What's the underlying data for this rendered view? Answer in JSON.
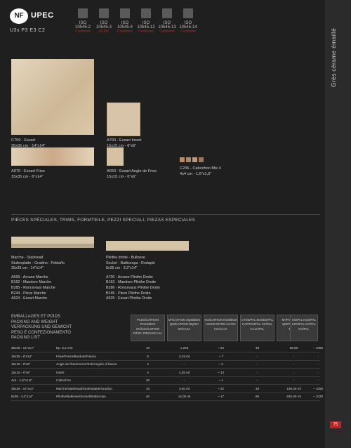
{
  "side_label": "Grès cérame émaillé",
  "logos": {
    "nf": "NF",
    "upec": "UPEC",
    "classification": "U3s P3 E3 C2"
  },
  "norms": [
    {
      "t1": "ISO",
      "t2": "10545-2",
      "t3": "Conforme"
    },
    {
      "t1": "ISO",
      "t2": "10545-3",
      "t3": "≤0,5%"
    },
    {
      "t1": "ISO",
      "t2": "10545-4",
      "t3": "Conforme"
    },
    {
      "t1": "ISO",
      "t2": "10545-12",
      "t3": "Conforme"
    },
    {
      "t1": "ISO",
      "t2": "10545-13",
      "t3": "Conforme"
    },
    {
      "t1": "ISO",
      "t2": "10545-14",
      "t3": "Conforme"
    }
  ],
  "products": {
    "big": {
      "code": "C759 - Essart",
      "size": "35x35 cm - 14\"x14\""
    },
    "insert": {
      "code": "A793 - Essart Insert",
      "size": "15x15 cm - 6\"x6\""
    },
    "frise": {
      "code": "A970 - Essart Frise",
      "size": "15x35 cm - 6\"x14\""
    },
    "angle": {
      "code": "A650 - Essart Angle de Frise",
      "size": "15x15 cm - 6\"x6\""
    },
    "cabochon": {
      "code": "C236 - Cabochon Mix 4",
      "size": "4x4 cm - 1,6\"x1,6\""
    }
  },
  "special_title": "PIÈCES SPÉCIALES, TRIMS, FORMTEILE, PEZZI SPECIALI, PIEZAS ESPECIALES",
  "marche": {
    "title1": "Marche - Stairtread",
    "title2": "Stufenplatte - Gradino - Peldaño",
    "size": "35x35 cm - 14\"x14\"",
    "items": [
      "A699 - Arcane Marche",
      "B162 - Mandore Marche",
      "B285 - Roncevaux Marche",
      "B244 - Pieve Marche",
      "A924 - Essart Marche"
    ]
  },
  "plinthe": {
    "title1": "Plinthe droite - Bullnose",
    "title2": "Sockel - Battiscopa - Rodapié",
    "size": "8x35 cm - 3,2\"x14\"",
    "items": [
      "A700 - Arcane Plinthe Droite",
      "B163 - Mandore Plinthe Droite",
      "B286 - Roncevaux Plinthe Droite",
      "B245 - Pieve Plinthe Droite",
      "A925 - Essart Plinthe Droite"
    ]
  },
  "packing_title": [
    "EMBALLAGES ET POIDS",
    "PACKING AND WEIGHT",
    "VERPACKUNG UND GEWICHT",
    "PESO E CONFEZIONAMENTO",
    "PACKING LIST"
  ],
  "col_headers": [
    "PCES/CARTON PCES/BOX STÜCK/KARTON PZ/SC PIEZAS/CAJA",
    "M²/CARTON SQM/BOX QM/KARTON MQ/SC M²/CAJA",
    "KG/CARTON KGS/BOX KGS/KARTON KG/SC KG/CAJA",
    "CTNS/PAL BOXES/PAL KARTON/PAL SC/PAL CAJA/PAL",
    "M²/PAL SQM/PAL QM/PAL MQ/PAL M²/PAL",
    "KG/PAL KGS/PAL KGS/PAL KG/PAL KG/PAL"
  ],
  "rows": [
    {
      "dim": "35x35 - 14\"x14\"",
      "desc": "Ep. 8,2 mm",
      "c": [
        "10",
        "1,225",
        "~ 22",
        "48",
        "58,80",
        "~ 1055"
      ]
    },
    {
      "dim": "15x35 - 6\"x14\"",
      "desc": "Frise/Frieze/Bordure/Fascia",
      "c": [
        "8",
        "3,15 ml",
        "~ 7",
        "-",
        "-",
        "-"
      ]
    },
    {
      "dim": "15x15 - 6\"x6\"",
      "desc": "Angle de frise/Corner/Eck/Angolo di fascia",
      "c": [
        "4",
        "-",
        "~ 3",
        "-",
        "-",
        "-"
      ]
    },
    {
      "dim": "15x15 - 6\"x6\"",
      "desc": "Insert",
      "c": [
        "4",
        "4,05 ml",
        "~ 13",
        "-",
        "-",
        "-"
      ]
    },
    {
      "dim": "4x4 - 1,6\"x1,6\"",
      "desc": "Cabochon",
      "c": [
        "40",
        "-",
        "~ 1",
        "-",
        "-",
        "-"
      ]
    },
    {
      "dim": "35x35 - 14\"x14\"",
      "desc": "Marche/Stairtread/Stufenplatte/Gradino",
      "c": [
        "10",
        "3,50 ml",
        "~ 22",
        "48",
        "168,00 ml",
        "~ 1055"
      ]
    },
    {
      "dim": "8x35 - 3,2\"x14\"",
      "desc": "Plinthe/Bullnose/Sockel/Battiscopa",
      "c": [
        "40",
        "14,00 ml",
        "~ 17",
        "60",
        "840,00 ml",
        "~ 1020"
      ]
    }
  ],
  "page_number": "75"
}
